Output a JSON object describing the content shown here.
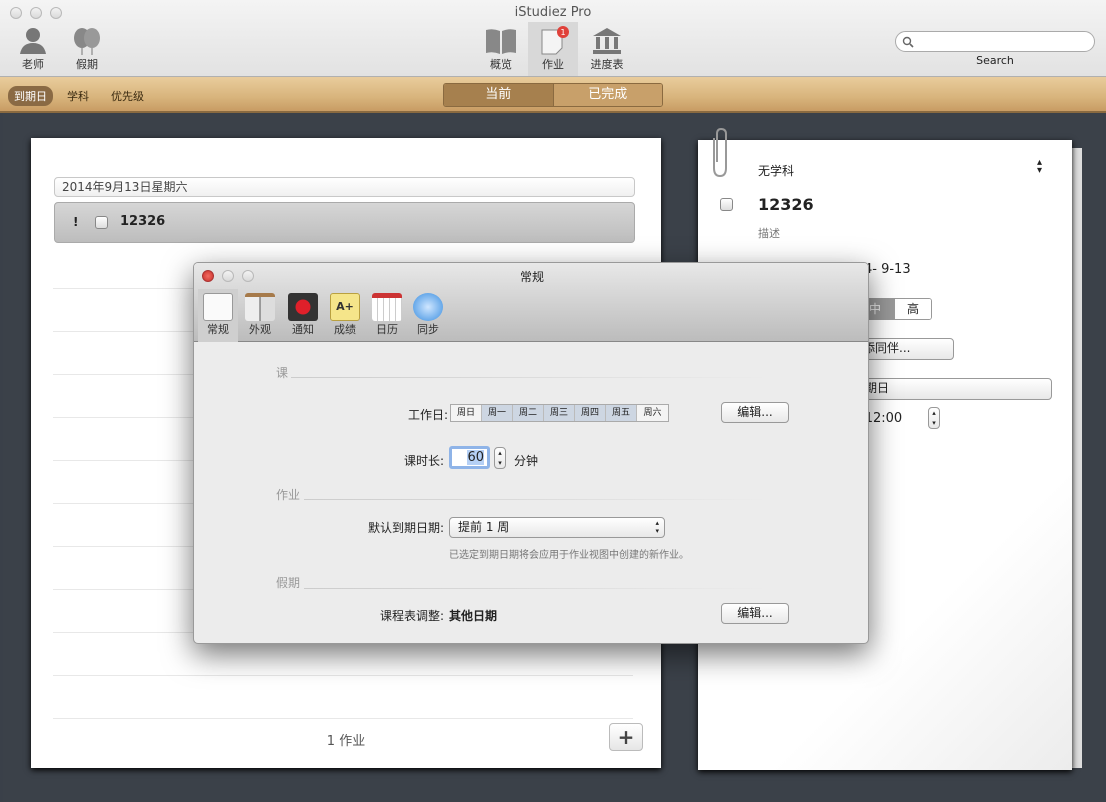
{
  "window": {
    "title": "iStudiez Pro"
  },
  "toolbar": {
    "left": [
      {
        "label": "老师",
        "icon": "teacher-icon"
      },
      {
        "label": "假期",
        "icon": "holidays-icon"
      }
    ],
    "center": [
      {
        "label": "概览",
        "icon": "book-icon"
      },
      {
        "label": "作业",
        "icon": "assignment-icon",
        "badge": "1",
        "active": true
      },
      {
        "label": "进度表",
        "icon": "schedule-icon"
      }
    ],
    "search": {
      "placeholder": "",
      "label": "Search"
    }
  },
  "filterbar": {
    "sort": [
      "到期日",
      "学科",
      "优先级"
    ],
    "segments": [
      "当前",
      "已完成"
    ],
    "active_segment": "当前"
  },
  "list": {
    "date_header": "2014年9月13日星期六",
    "task": {
      "priority": "!",
      "title": "12326",
      "checked": false
    },
    "count": "1 作业",
    "add": "+"
  },
  "detail": {
    "subject": "无学科",
    "title": "12326",
    "description": "描述",
    "due_fragment": "4- 9-13",
    "priority_visible": [
      "中",
      "高"
    ],
    "partner_fragment": "添同伴...",
    "reminder_fragment": "期日",
    "time_fragment": "-12:00"
  },
  "dialog": {
    "title": "常规",
    "tabs": [
      {
        "label": "常规",
        "icon": "switch-icon"
      },
      {
        "label": "外观",
        "icon": "appearance-icon"
      },
      {
        "label": "通知",
        "icon": "notification-icon"
      },
      {
        "label": "成绩",
        "icon": "grades-icon"
      },
      {
        "label": "日历",
        "icon": "calendar-icon"
      },
      {
        "label": "同步",
        "icon": "sync-icon"
      }
    ],
    "sections": {
      "classes": "课",
      "assignments": "作业",
      "holidays": "假期"
    },
    "workdays_label": "工作日:",
    "workdays": [
      {
        "d": "周日",
        "on": false
      },
      {
        "d": "周一",
        "on": true
      },
      {
        "d": "周二",
        "on": true
      },
      {
        "d": "周三",
        "on": true
      },
      {
        "d": "周四",
        "on": true
      },
      {
        "d": "周五",
        "on": true
      },
      {
        "d": "周六",
        "on": false
      }
    ],
    "edit": "编辑...",
    "duration_label": "课时长:",
    "duration_value": "60",
    "duration_unit": "分钟",
    "default_due_label": "默认到期日期:",
    "default_due_value": "提前 1 周",
    "default_due_hint": "已选定到期日期将会应用于作业视图中创建的新作业。",
    "schedule_adjust_label": "课程表调整:",
    "schedule_adjust_value": "其他日期"
  },
  "colors": {
    "accent": "#a6804e",
    "badge": "#e0413a",
    "close": "#e0443c"
  }
}
